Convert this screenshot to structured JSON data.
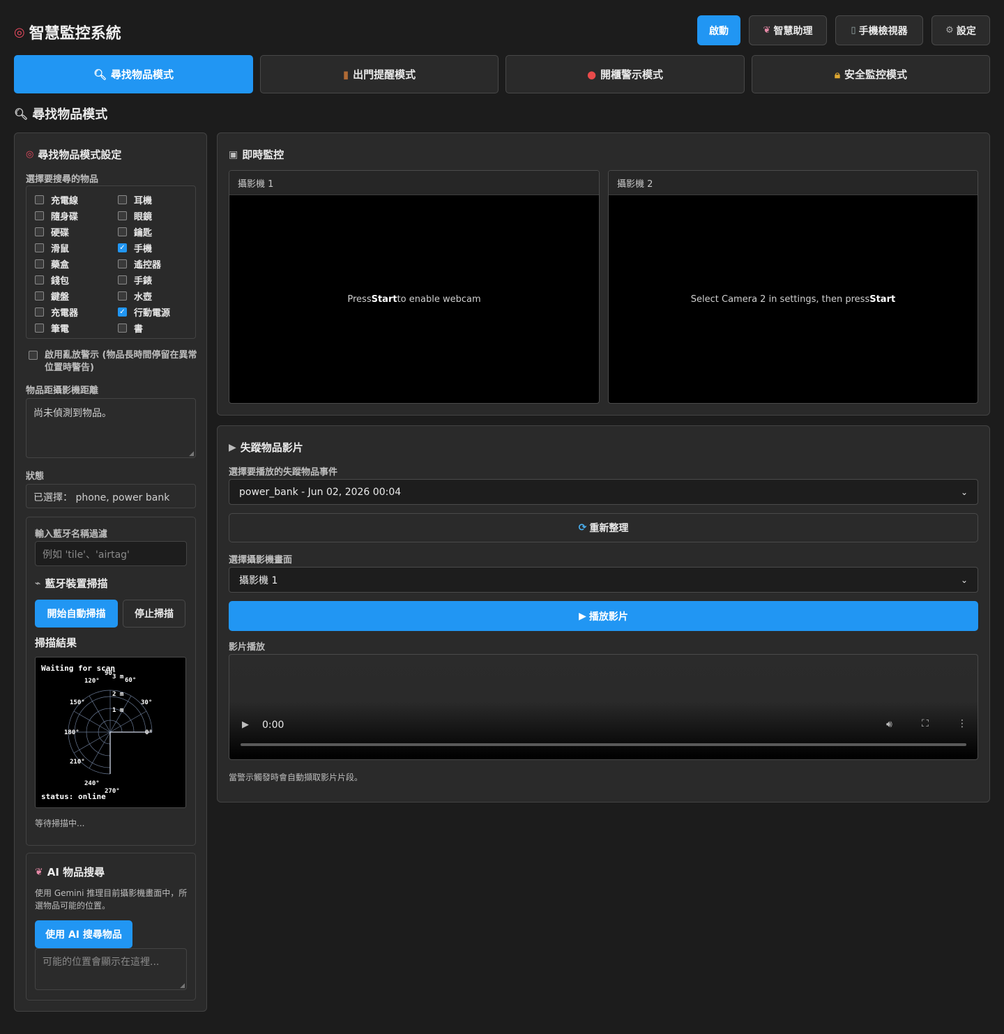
{
  "header": {
    "title": "智慧監控系統",
    "title_icon": "target-icon",
    "buttons": {
      "start": "啟動",
      "assistant": "智慧助理",
      "phone_viewer": "手機檢視器",
      "settings": "設定"
    }
  },
  "tabs": [
    {
      "label": "尋找物品模式",
      "icon": "magnifier-icon",
      "active": true
    },
    {
      "label": "出門提醒模式",
      "icon": "door-icon",
      "active": false
    },
    {
      "label": "開櫃警示模式",
      "icon": "siren-icon",
      "active": false
    },
    {
      "label": "安全監控模式",
      "icon": "lock-icon",
      "active": false
    }
  ],
  "section": {
    "heading": "尋找物品模式"
  },
  "settings": {
    "title": "尋找物品模式設定",
    "select_label": "選擇要搜尋的物品",
    "items": [
      {
        "label": "充電線",
        "checked": false
      },
      {
        "label": "耳機",
        "checked": false
      },
      {
        "label": "隨身碟",
        "checked": false
      },
      {
        "label": "眼鏡",
        "checked": false
      },
      {
        "label": "硬碟",
        "checked": false
      },
      {
        "label": "鑰匙",
        "checked": false
      },
      {
        "label": "滑鼠",
        "checked": false
      },
      {
        "label": "手機",
        "checked": true
      },
      {
        "label": "藥盒",
        "checked": false
      },
      {
        "label": "遙控器",
        "checked": false
      },
      {
        "label": "錢包",
        "checked": false
      },
      {
        "label": "手錶",
        "checked": false
      },
      {
        "label": "鍵盤",
        "checked": false
      },
      {
        "label": "水壺",
        "checked": false
      },
      {
        "label": "充電器",
        "checked": false
      },
      {
        "label": "行動電源",
        "checked": true
      },
      {
        "label": "筆電",
        "checked": false
      },
      {
        "label": "書",
        "checked": false
      }
    ],
    "clutter_warning": "啟用亂放警示 (物品長時間停留在異常位置時警告)",
    "distance_label": "物品距攝影機距離",
    "distance_text": "尚未偵測到物品。",
    "status_label": "狀態",
    "status_text": "已選擇： phone, power bank"
  },
  "bluetooth": {
    "filter_label": "輸入藍牙名稱過濾",
    "filter_placeholder": "例如 'tile'、'airtag'",
    "scan_title": "藍牙裝置掃描",
    "start_scan": "開始自動掃描",
    "stop_scan": "停止掃描",
    "results_title": "掃描結果",
    "radar": {
      "waiting_text": "Waiting for scan",
      "status_text": "status: online",
      "angle_labels": [
        "90°",
        "60°",
        "30°",
        "0°",
        "120°",
        "150°",
        "180°",
        "210°",
        "240°",
        "270°"
      ],
      "range_labels": [
        "3 m",
        "2 m",
        "1 m"
      ]
    },
    "scan_status": "等待掃描中..."
  },
  "ai_search": {
    "title": "AI 物品搜尋",
    "description": "使用 Gemini 推理目前攝影機畫面中，所選物品可能的位置。",
    "button": "使用 AI 搜尋物品",
    "result_placeholder": "可能的位置會顯示在這裡..."
  },
  "live": {
    "title": "即時監控",
    "cameras": [
      {
        "name": "攝影機 1",
        "msg_pre": "Press",
        "msg_bold": "Start",
        "msg_post": "to enable webcam"
      },
      {
        "name": "攝影機 2",
        "msg_pre": "Select Camera 2 in settings, then press",
        "msg_bold": "Start",
        "msg_post": ""
      }
    ]
  },
  "lost_video": {
    "title": "失蹤物品影片",
    "event_label": "選擇要播放的失蹤物品事件",
    "event_value": "power_bank - Jun 02, 2026 00:04",
    "refresh_button": "重新整理",
    "camera_label": "選擇攝影機畫面",
    "camera_value": "攝影機 1",
    "play_button": "播放影片",
    "playback_label": "影片播放",
    "time": "0:00",
    "note": "當警示觸發時會自動擷取影片片段。"
  },
  "colors": {
    "accent": "#2196f3",
    "background": "#1c1c1c",
    "panel": "#2a2a2a"
  }
}
